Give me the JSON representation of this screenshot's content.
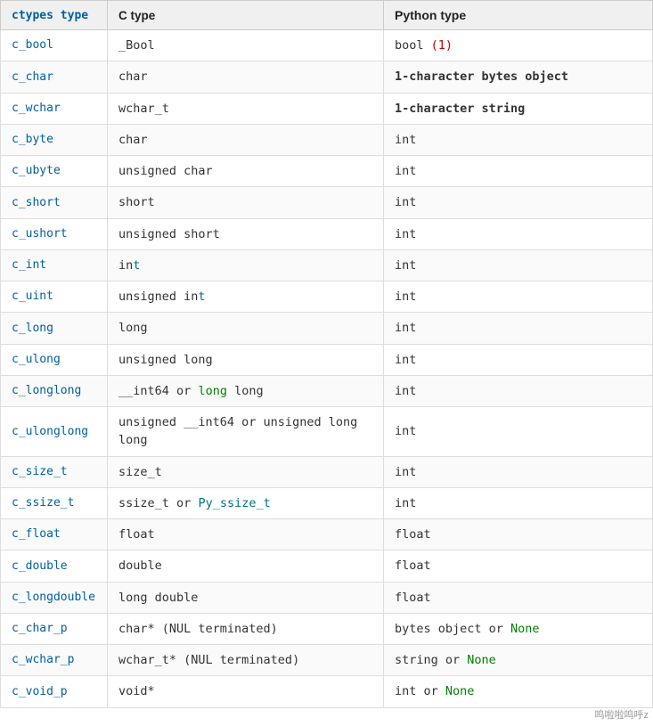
{
  "table": {
    "headers": [
      "ctypes type",
      "C type",
      "Python type"
    ],
    "rows": [
      {
        "ctypes": "c_bool",
        "ctype_html": "_Bool",
        "python_html": "bool <span class='kw-red'>(1)</span>"
      },
      {
        "ctypes": "c_char",
        "ctype_html": "char",
        "python_html": "<b>1-character bytes object</b>"
      },
      {
        "ctypes": "c_wchar",
        "ctype_html": "wchar_t",
        "python_html": "<b>1-character string</b>"
      },
      {
        "ctypes": "c_byte",
        "ctype_html": "char",
        "python_html": "int"
      },
      {
        "ctypes": "c_ubyte",
        "ctype_html": "unsigned char",
        "python_html": "int"
      },
      {
        "ctypes": "c_short",
        "ctype_html": "short",
        "python_html": "int"
      },
      {
        "ctypes": "c_ushort",
        "ctype_html": "unsigned short",
        "python_html": "int"
      },
      {
        "ctypes": "c_int",
        "ctype_html": "in<span class='kw-teal'>t</span>",
        "python_html": "int"
      },
      {
        "ctypes": "c_uint",
        "ctype_html": "unsigned in<span class='kw-teal'>t</span>",
        "python_html": "int"
      },
      {
        "ctypes": "c_long",
        "ctype_html": "long",
        "python_html": "int"
      },
      {
        "ctypes": "c_ulong",
        "ctype_html": "unsigned long",
        "python_html": "int"
      },
      {
        "ctypes": "c_longlong",
        "ctype_html": "__int64 <span class='normal'>or</span> <span class='kw-green'>long</span> long",
        "python_html": "int"
      },
      {
        "ctypes": "c_ulonglong",
        "ctype_html": "unsigned __int64 or unsigned long long",
        "python_html": "int"
      },
      {
        "ctypes": "c_size_t",
        "ctype_html": "size_t",
        "python_html": "int"
      },
      {
        "ctypes": "c_ssize_t",
        "ctype_html": "ssize_t <span class='normal'>or</span> <span class='kw-teal'>Py_ssize_t</span>",
        "python_html": "int"
      },
      {
        "ctypes": "c_float",
        "ctype_html": "float",
        "python_html": "float"
      },
      {
        "ctypes": "c_double",
        "ctype_html": "double",
        "python_html": "float"
      },
      {
        "ctypes": "c_longdouble",
        "ctype_html": "long double",
        "python_html": "float"
      },
      {
        "ctypes": "c_char_p",
        "ctype_html": "char* (NUL terminated)",
        "python_html": "bytes object or <span class='kw-green'>None</span>"
      },
      {
        "ctypes": "c_wchar_p",
        "ctype_html": "wchar_t* (NUL terminated)",
        "python_html": "string or <span class='kw-green'>None</span>"
      },
      {
        "ctypes": "c_void_p",
        "ctype_html": "void*",
        "python_html": "int or <span class='kw-green'>None</span>"
      }
    ]
  },
  "watermark": "鸣啦啦鸣呼z"
}
